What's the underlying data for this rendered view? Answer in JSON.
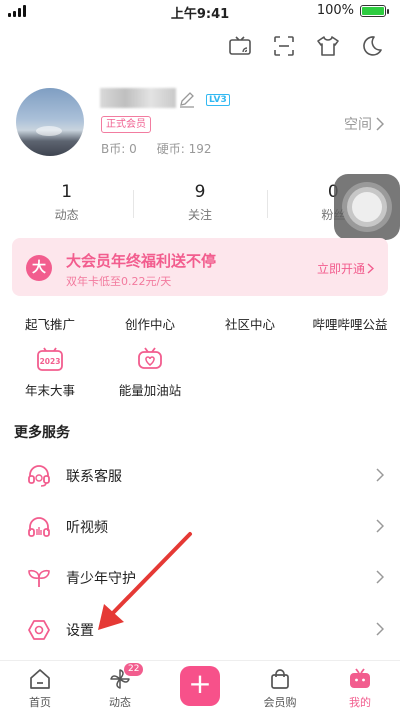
{
  "status_bar": {
    "time": "上午9:41",
    "battery": "100%"
  },
  "top_icons": [
    "tv-cast-icon",
    "scan-icon",
    "tshirt-icon",
    "moon-icon"
  ],
  "profile": {
    "level_badge": "LV3",
    "member_tag": "正式会员",
    "space_label": "空间",
    "bcoin": "B币: 0",
    "coin": "硬币: 192"
  },
  "stats": [
    {
      "num": "1",
      "label": "动态"
    },
    {
      "num": "9",
      "label": "关注"
    },
    {
      "num": "0",
      "label": "粉丝"
    }
  ],
  "vip": {
    "logo": "大",
    "title": "大会员年终福利送不停",
    "subtitle": "双年卡低至0.22元/天",
    "cta": "立即开通"
  },
  "grid_row1": [
    "起飞推广",
    "创作中心",
    "社区中心",
    "哔哩哔哩公益"
  ],
  "grid_row2": [
    {
      "label": "年末大事",
      "icon": "calendar-2023-icon",
      "icon_text": "2023"
    },
    {
      "label": "能量加油站",
      "icon": "energy-tv-icon"
    }
  ],
  "more_services": {
    "title": "更多服务",
    "items": [
      {
        "label": "联系客服",
        "icon": "headset-icon"
      },
      {
        "label": "听视频",
        "icon": "headphones-icon"
      },
      {
        "label": "青少年守护",
        "icon": "sprout-icon"
      },
      {
        "label": "设置",
        "icon": "settings-hex-icon"
      }
    ]
  },
  "tabbar": {
    "tabs": [
      {
        "label": "首页",
        "icon": "home-icon"
      },
      {
        "label": "动态",
        "icon": "pinwheel-icon",
        "badge": "22"
      },
      {
        "label": "",
        "icon": "plus-icon"
      },
      {
        "label": "会员购",
        "icon": "shopping-bag-icon"
      },
      {
        "label": "我的",
        "icon": "my-tv-icon"
      }
    ],
    "active": "我的"
  },
  "colors": {
    "accent": "#f25d8e",
    "vip_bg": "#fde6ec",
    "annotation_arrow": "#e53935"
  }
}
